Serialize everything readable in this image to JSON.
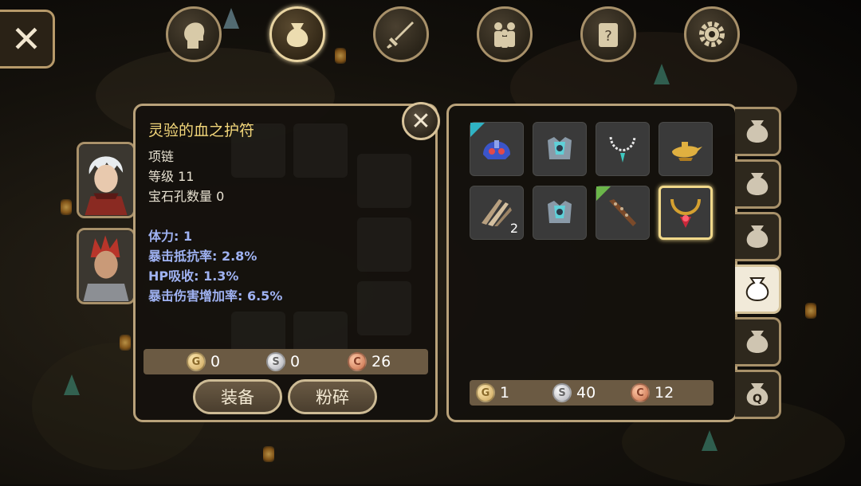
{
  "top_nav": {
    "close_symbol": "✕",
    "items": [
      {
        "name": "character-tab",
        "icon": "head-silhouette-icon",
        "active": false
      },
      {
        "name": "bag-tab",
        "icon": "bag-icon",
        "active": true
      },
      {
        "name": "skills-tab",
        "icon": "sword-icon",
        "active": false
      },
      {
        "name": "party-tab",
        "icon": "party-icon",
        "active": false
      },
      {
        "name": "quest-tab",
        "icon": "scroll-icon",
        "active": false
      },
      {
        "name": "settings-tab",
        "icon": "gear-icon",
        "active": false
      }
    ]
  },
  "detail": {
    "title": "灵验的血之护符",
    "close_symbol": "✕",
    "type": "项链",
    "level": "等级 11",
    "gem_slots": "宝石孔数量 0",
    "stats": [
      "体力: 1",
      "暴击抵抗率: 2.8%",
      "HP吸收: 1.3%",
      "暴击伤害增加率: 6.5%"
    ],
    "price": {
      "gold": "0",
      "silver": "0",
      "copper": "26"
    },
    "buttons": {
      "equip": "装备",
      "smash": "粉碎"
    }
  },
  "inventory": {
    "items": [
      {
        "name": "blue-helmet",
        "icon": "helmet-icon",
        "marker": "teal",
        "count": ""
      },
      {
        "name": "crystal-armor",
        "icon": "armor-icon",
        "marker": "",
        "count": ""
      },
      {
        "name": "silver-necklace",
        "icon": "necklace-icon",
        "marker": "",
        "count": ""
      },
      {
        "name": "magic-lamp",
        "icon": "lamp-icon",
        "marker": "",
        "count": ""
      },
      {
        "name": "claw-material",
        "icon": "claw-icon",
        "marker": "",
        "count": "2"
      },
      {
        "name": "crystal-armor-2",
        "icon": "armor-icon",
        "marker": "",
        "count": ""
      },
      {
        "name": "spiked-club",
        "icon": "club-icon",
        "marker": "green",
        "count": ""
      },
      {
        "name": "blood-amulet",
        "icon": "amulet-icon",
        "marker": "",
        "count": "",
        "selected": true
      }
    ],
    "money": {
      "gold": "1",
      "silver": "40",
      "copper": "12"
    }
  },
  "side_tabs": [
    {
      "icon": "bag-icon",
      "active": false
    },
    {
      "icon": "bag-icon",
      "active": false
    },
    {
      "icon": "bag-icon",
      "active": false
    },
    {
      "icon": "bag-icon",
      "active": true
    },
    {
      "icon": "bag-icon",
      "active": false
    },
    {
      "icon": "quest-bag-icon",
      "label": "Q",
      "active": false
    }
  ],
  "coin_letters": {
    "gold": "G",
    "silver": "S",
    "copper": "C"
  },
  "colors": {
    "title": "#f3d77a",
    "stat_blue": "#9fb2f2",
    "panel_border": "#b9a27a",
    "selected_border": "#f0d88a"
  }
}
